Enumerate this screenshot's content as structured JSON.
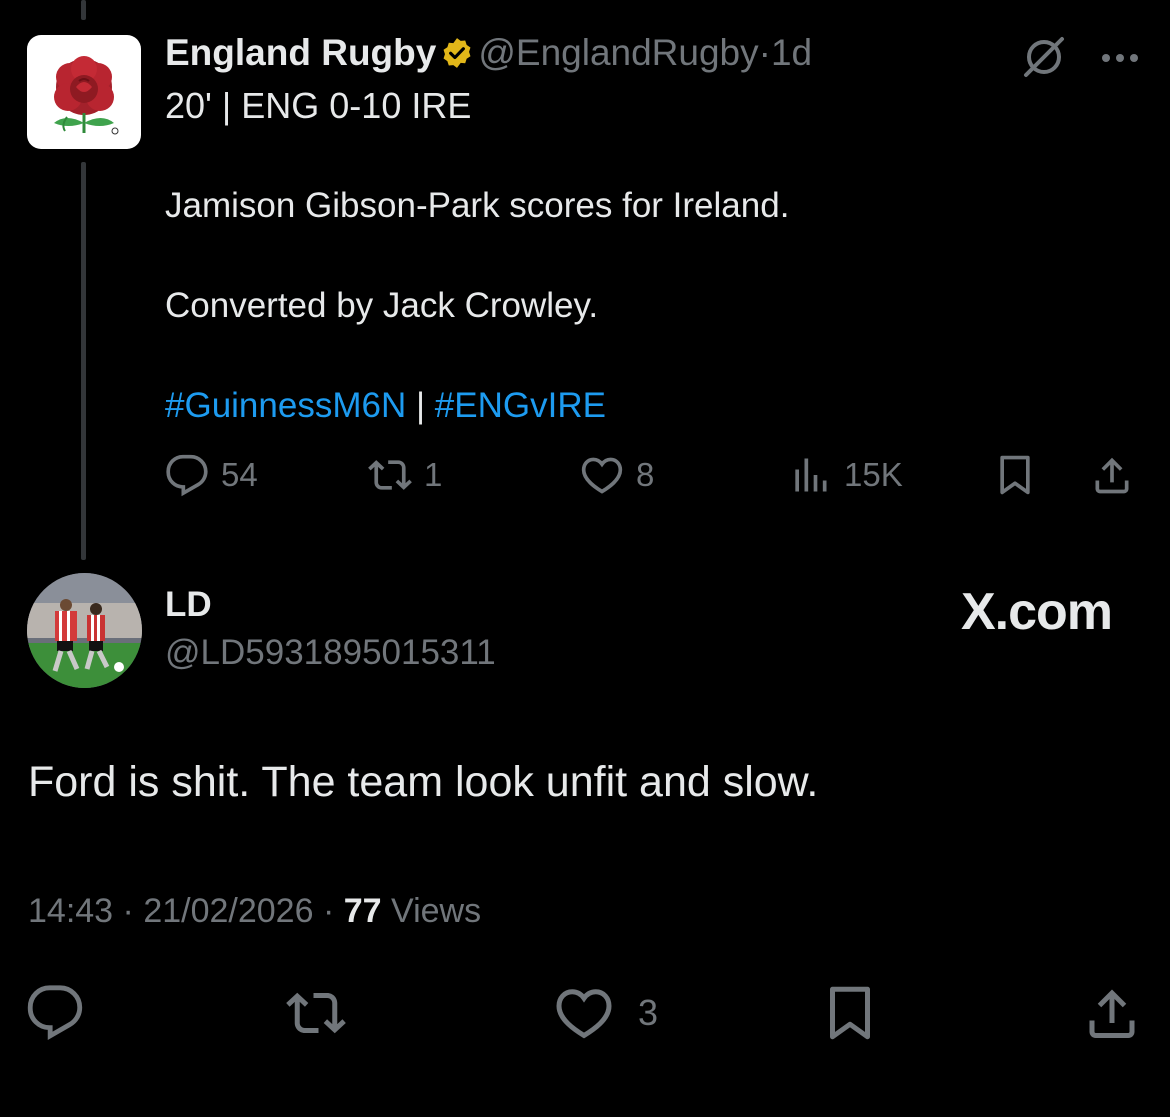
{
  "tweet": {
    "display_name": "England Rugby",
    "handle": "@EnglandRugby",
    "separator": "·",
    "age": "1d",
    "line1": "20' | ENG 0-10 IRE",
    "line2": "Jamison Gibson-Park scores for Ireland.",
    "line3": "Converted by Jack Crowley.",
    "hashtag1": "#GuinnessM6N",
    "hashtag_sep": "|",
    "hashtag2": "#ENGvIRE",
    "replies": "54",
    "reposts": "1",
    "likes": "8",
    "views": "15K",
    "icons": [
      "verified-badge-icon",
      "grok-icon",
      "more-icon",
      "reply-icon",
      "repost-icon",
      "like-icon",
      "views-icon",
      "bookmark-icon",
      "share-icon"
    ]
  },
  "reply": {
    "display_name": "LD",
    "handle": "@LD5931895015311",
    "brand": "X.com",
    "text": "Ford is shit. The team look unfit and slow.",
    "time": "14:43",
    "dot": "·",
    "date": "21/02/2026",
    "views_count": "77",
    "views_label": "Views",
    "likes": "3"
  },
  "colors": {
    "background": "#000000",
    "text": "#e7e9ea",
    "muted": "#71767b",
    "link": "#1d9bf0",
    "verified_gold": "#e2b719",
    "thread_line": "#333639"
  }
}
